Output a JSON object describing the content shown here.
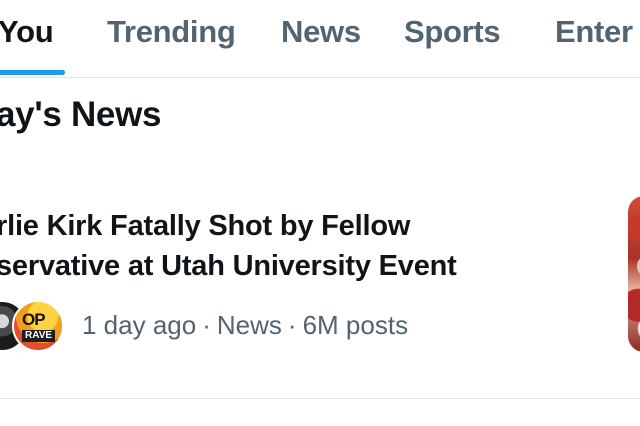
{
  "tabs": [
    {
      "label": "You",
      "active": true
    },
    {
      "label": "Trending",
      "active": false
    },
    {
      "label": "News",
      "active": false
    },
    {
      "label": "Sports",
      "active": false
    },
    {
      "label": "Enter",
      "active": false
    }
  ],
  "accent_color": "#1d9bf0",
  "section": {
    "title": "ay's News"
  },
  "news_item": {
    "headline_line1": "rlie Kirk Fatally Shot by Fellow",
    "headline_line2": "servative at Utah University Event",
    "avatars": [
      {
        "name": "person-avatar"
      },
      {
        "name": "pop-crave-avatar",
        "text_top": "OP",
        "text_bottom": "RAVE"
      }
    ],
    "meta": {
      "time": "1 day ago",
      "category": "News",
      "posts": "6M posts",
      "separator": "·"
    },
    "thumbnail_icon": "news-thumbnail"
  }
}
